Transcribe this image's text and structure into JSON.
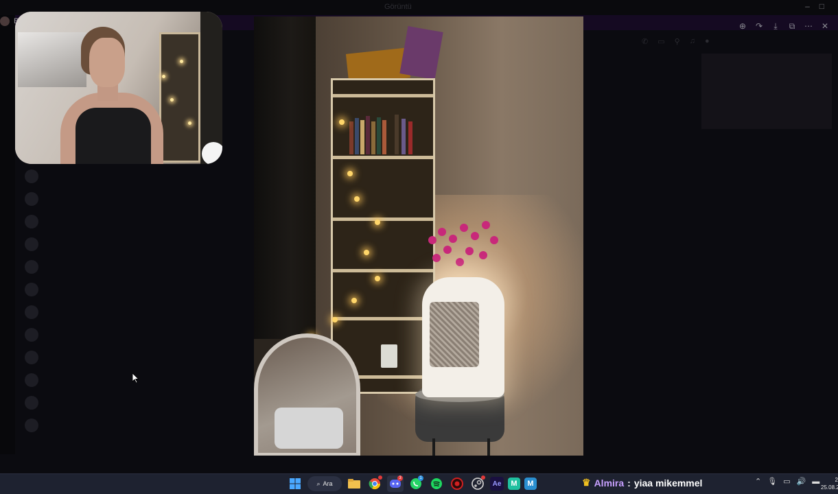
{
  "window": {
    "title": "Görüntü",
    "controls": [
      "–",
      "□",
      "✕"
    ],
    "sidebar_initial": "B"
  },
  "viewer_toolbar": {
    "icons": [
      "zoom-in-icon",
      "share-icon",
      "download-icon",
      "open-external-icon",
      "more-icon"
    ],
    "close_icon": "close-icon"
  },
  "notification": {
    "user": "Almira",
    "separator": ":",
    "message": "yiaa mikemmel"
  },
  "taskbar": {
    "search_label": "Ara",
    "apps": [
      {
        "name": "windows-start-icon",
        "glyph": "⊞",
        "color": "#4aa8ff"
      },
      {
        "name": "search-icon",
        "glyph": "🔍",
        "color": "#ffffff"
      },
      {
        "name": "file-explorer-icon",
        "glyph": "▬",
        "color": "#f2c14e"
      },
      {
        "name": "chrome-icon",
        "glyph": "◉",
        "color": "#e94a3a"
      },
      {
        "name": "discord-icon",
        "glyph": "◕",
        "color": "#5865f2"
      },
      {
        "name": "whatsapp-icon",
        "glyph": "✆",
        "color": "#25d366"
      },
      {
        "name": "spotify-icon",
        "glyph": "≋",
        "color": "#1ed760"
      },
      {
        "name": "record-icon",
        "glyph": "●",
        "color": "#d02020"
      },
      {
        "name": "steam-icon",
        "glyph": "⚙",
        "color": "#c8c8c8"
      },
      {
        "name": "after-effects-icon",
        "glyph": "Ae",
        "color": "#9999ff"
      },
      {
        "name": "app-m-icon",
        "glyph": "M",
        "color": "#20c0a0"
      },
      {
        "name": "app-m2-icon",
        "glyph": "M",
        "color": "#3aa0e0"
      }
    ],
    "badges": {
      "chrome": "",
      "discord": "3",
      "whatsapp": "1",
      "steam": ""
    }
  },
  "tray": {
    "icons": [
      "chevron-up-icon",
      "microphone-icon",
      "display-icon",
      "speaker-icon",
      "battery-icon"
    ],
    "time": "2",
    "date": "25.08.2"
  }
}
